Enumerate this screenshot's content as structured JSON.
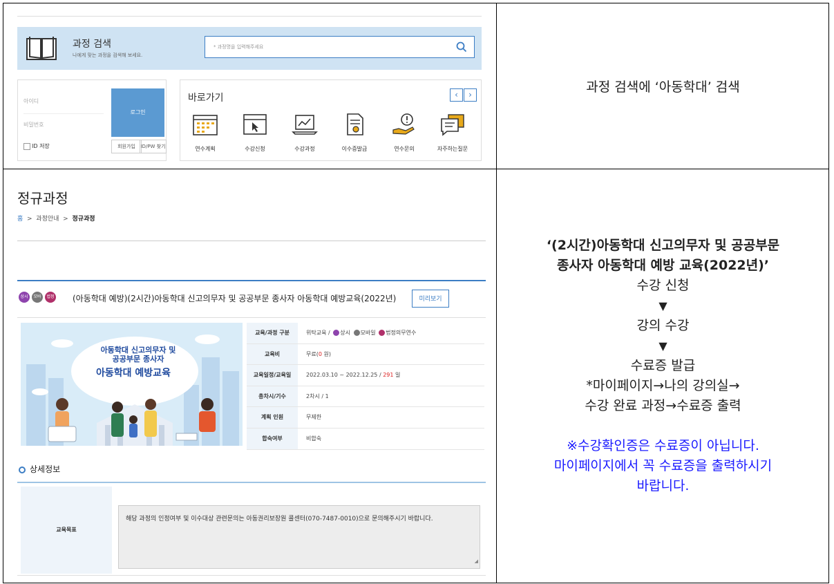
{
  "top_panel": {
    "search": {
      "title": "과정 검색",
      "subtitle": "나에게 맞는 과정을 검색해 보세요.",
      "placeholder": "* 과정명을 입력해주세요"
    },
    "login": {
      "id_placeholder": "아이디",
      "pw_placeholder": "비밀번호",
      "login_label": "로그인",
      "save_id_label": "ID 저장",
      "join_label": "회원가입",
      "find_label": "ID/PW 찾기"
    },
    "shortcuts": {
      "title": "바로가기",
      "prev": "‹",
      "next": "›",
      "items": [
        {
          "label": "연수계획",
          "icon": "calendar-icon"
        },
        {
          "label": "수강신청",
          "icon": "window-cursor-icon"
        },
        {
          "label": "수강과정",
          "icon": "laptop-chart-icon"
        },
        {
          "label": "이수증발급",
          "icon": "certificate-icon"
        },
        {
          "label": "연수문의",
          "icon": "hand-exclamation-icon"
        },
        {
          "label": "자주하는질문",
          "icon": "speech-bubble-icon"
        }
      ]
    }
  },
  "top_note": "과정 검색에 ‘아동학대’ 검색",
  "bottom_panel": {
    "page_title": "정규과정",
    "breadcrumb": {
      "home": "홈",
      "sep": ">",
      "level1": "과정안내",
      "current": "정규과정"
    },
    "badges": [
      {
        "label": "상시",
        "color": "#8e44ad"
      },
      {
        "label": "모바일",
        "color": "#777777"
      },
      {
        "label": "법정",
        "color": "#b0306a"
      }
    ],
    "course_title": "(아동학대 예방)(2시간)아동학대 신고의무자 및 공공부문 종사자 아동학대 예방교육(2022년)",
    "preview_label": "미리보기",
    "banner": {
      "line1": "아동학대 신고의무자 및",
      "line2": "공공부문 종사자",
      "line3": "아동학대 예방교육"
    },
    "info": {
      "type_key": "교육/과정 구분",
      "type_val_prefix": "위탁교육 /",
      "type_badge1": "상시",
      "type_badge2": "모바일",
      "type_badge3": "법정의무연수",
      "fee_key": "교육비",
      "fee_prefix": "무료(",
      "fee_amount": "0",
      "fee_suffix": " 원)",
      "period_key": "교육일정/교육일",
      "period_dates": "2022.03.10 ~ 2022.12.25 /",
      "period_days": "291",
      "period_unit": " 일",
      "hours_key": "총차시/기수",
      "hours_val": "2차시 / 1",
      "plan_key": "계획 인원",
      "plan_val": "무제한",
      "pass_key": "합숙여부",
      "pass_val": "비합숙"
    },
    "detail_heading": "상세정보",
    "goal_key": "교육목표",
    "goal_text": "해당 과정의 인정여부 및 이수대상 관련문의는 아동권리보장원 콜센터(070-7487-0010)으로 문의해주시기 바랍니다."
  },
  "bottom_note": {
    "title_line1": "‘(2시간)아동학대 신고의무자 및 공공부문",
    "title_line2": "종사자 아동학대 예방 교육(2022년)’",
    "step1": "수강 신청",
    "arrow": "▼",
    "step2": "강의 수강",
    "step3": "수료증 발급",
    "path_line1": "*마이페이지→나의 강의실→",
    "path_line2": "수강 완료 과정→수료증 출력",
    "warn_line1": "※수강확인증은 수료증이 아닙니다.",
    "warn_line2": "마이페이지에서 꼭 수료증을 출력하시기",
    "warn_line3": "바랍니다."
  }
}
